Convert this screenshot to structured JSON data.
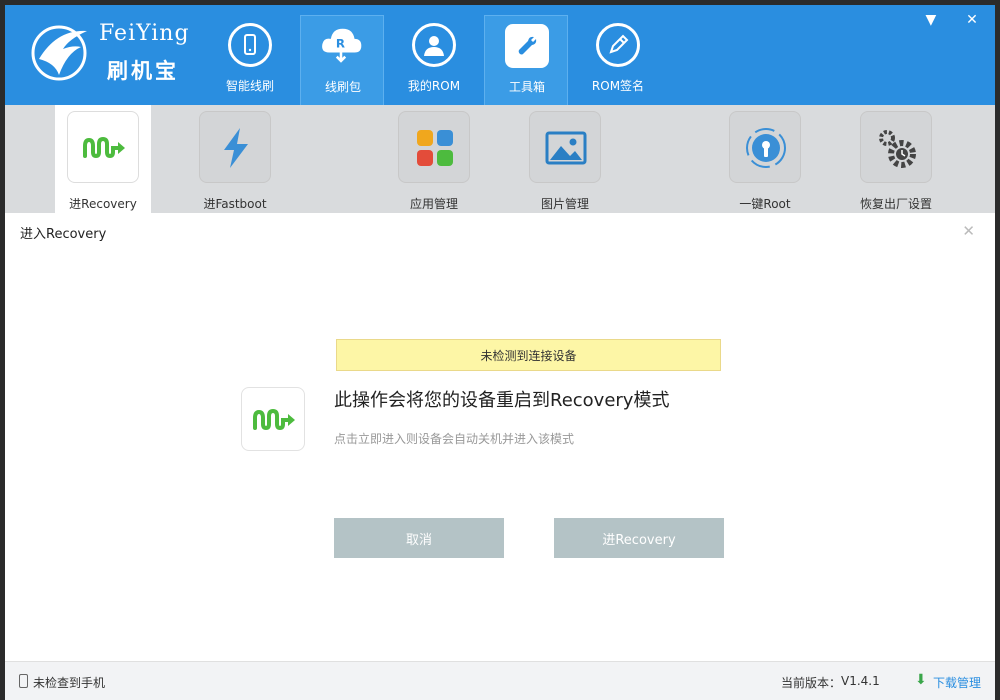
{
  "app": {
    "logo_en": "FeiYing",
    "logo_cn": "刷机宝"
  },
  "nav": [
    {
      "label": "智能线刷",
      "icon": "phone-refresh-icon"
    },
    {
      "label": "线刷包",
      "icon": "cloud-download-icon"
    },
    {
      "label": "我的ROM",
      "icon": "user-icon"
    },
    {
      "label": "工具箱",
      "icon": "wrench-icon"
    },
    {
      "label": "ROM签名",
      "icon": "pen-icon"
    }
  ],
  "window_controls": {
    "menu": "▼",
    "close": "✕"
  },
  "tools": [
    {
      "label": "进Recovery",
      "icon": "recovery-arrow-icon"
    },
    {
      "label": "进Fastboot",
      "icon": "lightning-icon"
    },
    {
      "label": "应用管理",
      "icon": "apps-grid-icon"
    },
    {
      "label": "图片管理",
      "icon": "image-icon"
    },
    {
      "label": "一键Root",
      "icon": "root-lock-icon"
    },
    {
      "label": "恢复出厂设置",
      "icon": "gears-icon"
    }
  ],
  "panel": {
    "title": "进入Recovery",
    "close": "✕",
    "notice": "未检测到连接设备",
    "heading": "此操作会将您的设备重启到Recovery模式",
    "subtext": "点击立即进入则设备会自动关机并进入该模式",
    "cancel_label": "取消",
    "confirm_label": "进Recovery"
  },
  "status": {
    "device": "未检查到手机",
    "version_label": "当前版本：",
    "version": "V1.4.1",
    "download_label": "下载管理"
  },
  "colors": {
    "header": "#2a8ee0",
    "toolbar": "#d9dbdd",
    "notice_bg": "#fdf6a6",
    "button": "#b4c3c6",
    "accent_green": "#4dbb3e"
  }
}
